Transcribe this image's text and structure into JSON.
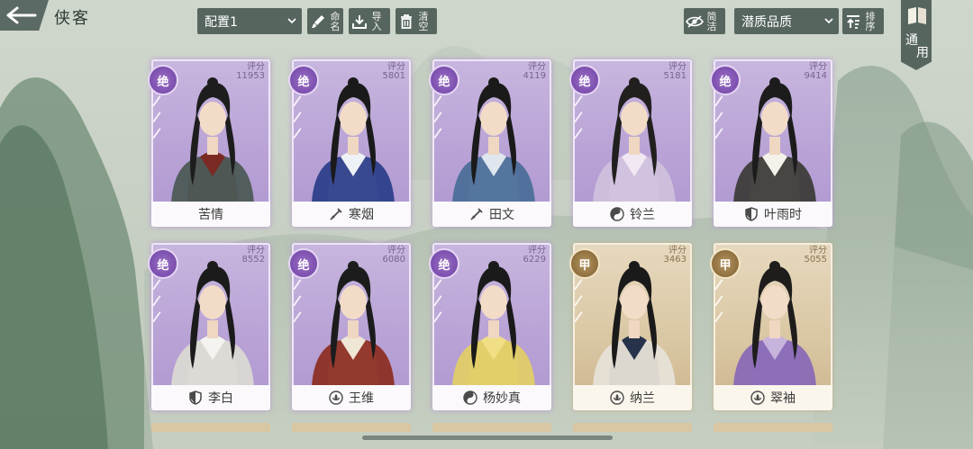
{
  "header": {
    "title": "侠客",
    "config_select": "配置1",
    "rename_label": "命名",
    "import_label": "导入",
    "clear_label": "清空",
    "simple_label": "简洁",
    "quality_select": "潜质品质",
    "sort_label": "排序",
    "general_label_1": "通",
    "general_label_2": "用"
  },
  "colors": {
    "toolbar": "#56665f",
    "purple_card": "#b9a3d6",
    "gold_card": "#d9c6a2"
  },
  "cards": [
    {
      "name": "苦情",
      "grade": "绝",
      "score_label": "评分",
      "score": "11953",
      "icon": "none",
      "tier": "purple",
      "hair": "#1d1d1d",
      "robe": "#7a2a23",
      "robe2": "#4d5a57"
    },
    {
      "name": "寒烟",
      "grade": "绝",
      "score_label": "评分",
      "score": "5801",
      "icon": "sword-icon",
      "tier": "purple",
      "hair": "#1a1a1a",
      "robe": "#eef1f6",
      "robe2": "#2d3f8a"
    },
    {
      "name": "田文",
      "grade": "绝",
      "score_label": "评分",
      "score": "4119",
      "icon": "sword-icon",
      "tier": "purple",
      "hair": "#1a1a1a",
      "robe": "#dfe6ee",
      "robe2": "#4c6f99"
    },
    {
      "name": "铃兰",
      "grade": "绝",
      "score_label": "评分",
      "score": "5181",
      "icon": "taiji-icon",
      "tier": "purple",
      "hair": "#22201f",
      "robe": "#f2e8f3",
      "robe2": "#cfc0dd"
    },
    {
      "name": "叶雨时",
      "grade": "绝",
      "score_label": "评分",
      "score": "9414",
      "icon": "shield-icon",
      "tier": "purple",
      "hair": "#1c1c1c",
      "robe": "#f3f1ea",
      "robe2": "#3e3c3a"
    },
    {
      "name": "李白",
      "grade": "绝",
      "score_label": "评分",
      "score": "8552",
      "icon": "shield-icon",
      "tier": "purple",
      "hair": "#1b1b1b",
      "robe": "#f4f3ef",
      "robe2": "#dad8d2"
    },
    {
      "name": "王维",
      "grade": "绝",
      "score_label": "评分",
      "score": "6080",
      "icon": "lotus-icon",
      "tier": "purple",
      "hair": "#1c1c1c",
      "robe": "#efe6d6",
      "robe2": "#8e2f24"
    },
    {
      "name": "杨妙真",
      "grade": "绝",
      "score_label": "评分",
      "score": "6229",
      "icon": "taiji-icon",
      "tier": "purple",
      "hair": "#1a1a1a",
      "robe": "#f0df84",
      "robe2": "#e2cd68"
    },
    {
      "name": "纳兰",
      "grade": "甲",
      "score_label": "评分",
      "score": "3463",
      "icon": "lotus-icon",
      "tier": "gold",
      "hair": "#1a1a1a",
      "robe": "#26334a",
      "robe2": "#e6e1d6"
    },
    {
      "name": "翠袖",
      "grade": "甲",
      "score_label": "评分",
      "score": "5055",
      "icon": "lotus-icon",
      "tier": "gold",
      "hair": "#1e1d1c",
      "robe": "#c7b4dc",
      "robe2": "#8a6ab6"
    }
  ]
}
